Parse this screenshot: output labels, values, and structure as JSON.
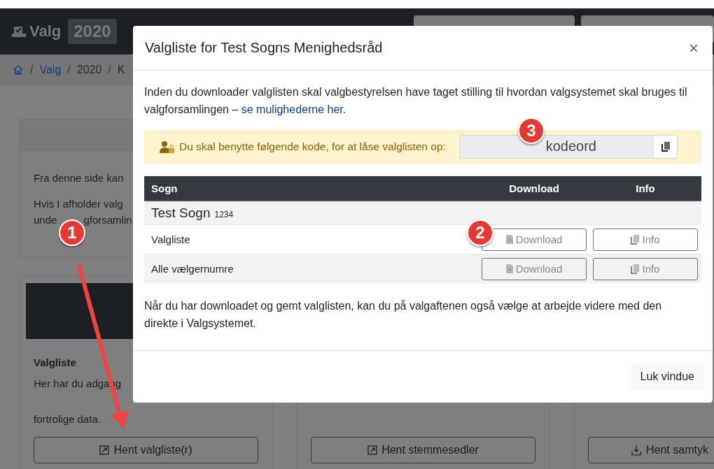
{
  "navbar": {
    "brand": "Valg",
    "year": "2020"
  },
  "breadcrumb": [
    {
      "label": "Valg",
      "kind": "link",
      "separator": "/"
    },
    {
      "label": "2020",
      "kind": "text",
      "separator": "/"
    },
    {
      "label": "K",
      "kind": "text",
      "separator": "/"
    }
  ],
  "intro_card": {
    "lines": [
      "Fra denne side kan",
      "Hvis I afholder valg"
    ],
    "split_line": [
      "unde",
      "gforsamlin"
    ]
  },
  "cards": [
    {
      "title": "Valgliste",
      "lines": [
        "Her har du adgang",
        "fortrolige data."
      ],
      "button": "Hent valgliste(r)",
      "kind": "external"
    },
    {
      "button": "Hent stemmesedler",
      "kind": "external"
    },
    {
      "button": "Hent samtyk",
      "kind": "download"
    }
  ],
  "modal": {
    "title": "Valgliste for Test Sogns Menighedsråd",
    "close": "×",
    "intro": "Inden du downloader valglisten skal valgbestyrelsen have taget stilling til hvordan valgsystemet skal bruges til valgforsamlingen –",
    "intro_link": "se mulighederne her.",
    "alert": {
      "text": "Du skal benytte følgende kode, for at låse valglisten op:",
      "code": "kodeord"
    },
    "table": {
      "columns": [
        "Sogn",
        "Download",
        "Info"
      ],
      "group": {
        "name": "Test Sogn",
        "number": "1234"
      },
      "rows": [
        {
          "label": "Valgliste",
          "download": "Download",
          "info": "Info"
        },
        {
          "label": "Alle vælgernumre",
          "download": "Download",
          "info": "Info"
        }
      ]
    },
    "outro": "Når du har downloadet og gemt valglisten, kan du på valgaftenen også vælge at arbejde videre med den direkte i Valgsystemet.",
    "footer_button": "Luk vindue"
  },
  "annotations": [
    {
      "label": "1"
    },
    {
      "label": "2"
    },
    {
      "label": "3"
    }
  ]
}
